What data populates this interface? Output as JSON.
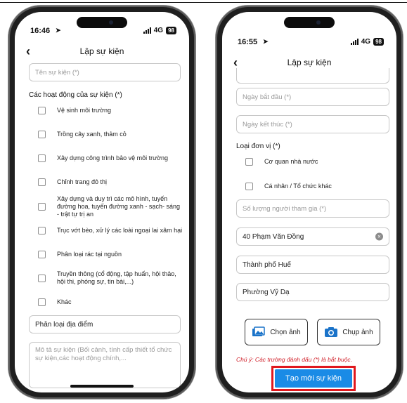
{
  "left": {
    "status_time": "16:46",
    "status_net": "4G",
    "status_battery": "98",
    "nav_title": "Lập sự kiện",
    "event_name_placeholder": "Tên sự kiện (*)",
    "activities_label": "Các hoạt động của sự kiện (*)",
    "activities": [
      "Vệ sinh môi trường",
      "Trồng cây xanh, thảm cỏ",
      "Xây dựng công trình bảo vệ môi trường",
      "Chỉnh trang đô thị",
      "Xây dựng và duy trì các mô hình, tuyến đường hoa, tuyến đường xanh - sạch- sáng - trật tự trị an",
      "Trục vớt bèo, xử lý các loài ngoại lai xâm hại",
      "Phân loại rác tại nguồn",
      "Truyền thông (cổ động, tập huấn, hội thảo, hội thi, phóng sự, tin bài,...)",
      "Khác"
    ],
    "location_type_value": "Phân loại địa điểm",
    "description_placeholder": "Mô tả sự kiện (Bối cảnh, tính cấp thiết tổ chức sự kiện,các hoạt động chính,..."
  },
  "right": {
    "status_time": "16:55",
    "status_net": "4G",
    "status_battery": "98",
    "nav_title": "Lập sự kiện",
    "start_date_placeholder": "Ngày bắt đầu (*)",
    "end_date_placeholder": "Ngày kết thúc (*)",
    "unit_type_label": "Loại đơn vị (*)",
    "unit_types": [
      "Cơ quan nhà nước",
      "Cá nhân / Tổ chức khác"
    ],
    "participants_placeholder": "Số lượng người tham gia (*)",
    "address_value": "40 Phạm Văn Đồng",
    "city_value": "Thành phố Huế",
    "ward_value": "Phường Vỹ Dạ",
    "choose_photo_label": "Chọn ảnh",
    "take_photo_label": "Chụp ảnh",
    "note": "Chú ý: Các trường đánh dấu (*) là bắt buộc.",
    "submit_label": "Tạo mới sự kiện"
  },
  "colors": {
    "accent": "#1a8be6",
    "highlight": "#e0181e",
    "note": "#d0202a"
  }
}
